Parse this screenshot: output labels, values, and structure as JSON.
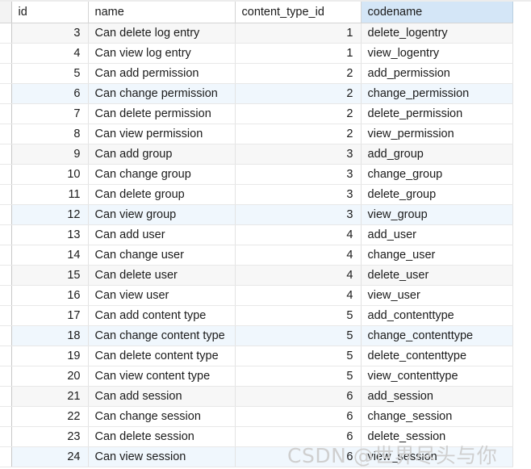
{
  "grid": {
    "columns": [
      {
        "key": "gutter",
        "label": "",
        "align": "left",
        "selected": false
      },
      {
        "key": "id",
        "label": "id",
        "align": "right",
        "selected": false
      },
      {
        "key": "name",
        "label": "name",
        "align": "left",
        "selected": false
      },
      {
        "key": "content_type_id",
        "label": "content_type_id",
        "align": "right",
        "selected": false
      },
      {
        "key": "codename",
        "label": "codename",
        "align": "left",
        "selected": true
      }
    ],
    "selected_column": "codename",
    "colors": {
      "header_selected_bg": "#d4e6f7",
      "row_white_bg": "#ffffff",
      "row_grey_bg": "#f7f7f7",
      "row_blue_bg": "#f0f7fd",
      "grid_line": "#e3e3e3",
      "header_border": "#d4d4d4",
      "text": "#1b1b1b",
      "watermark": "#cfcfcf"
    },
    "rows": [
      {
        "id": "3",
        "name": "Can delete log entry",
        "content_type_id": "1",
        "codename": "delete_logentry",
        "stripe": "grey"
      },
      {
        "id": "4",
        "name": "Can view log entry",
        "content_type_id": "1",
        "codename": "view_logentry",
        "stripe": "white"
      },
      {
        "id": "5",
        "name": "Can add permission",
        "content_type_id": "2",
        "codename": "add_permission",
        "stripe": "white"
      },
      {
        "id": "6",
        "name": "Can change permission",
        "content_type_id": "2",
        "codename": "change_permission",
        "stripe": "blue"
      },
      {
        "id": "7",
        "name": "Can delete permission",
        "content_type_id": "2",
        "codename": "delete_permission",
        "stripe": "white"
      },
      {
        "id": "8",
        "name": "Can view permission",
        "content_type_id": "2",
        "codename": "view_permission",
        "stripe": "white"
      },
      {
        "id": "9",
        "name": "Can add group",
        "content_type_id": "3",
        "codename": "add_group",
        "stripe": "grey"
      },
      {
        "id": "10",
        "name": "Can change group",
        "content_type_id": "3",
        "codename": "change_group",
        "stripe": "white"
      },
      {
        "id": "11",
        "name": "Can delete group",
        "content_type_id": "3",
        "codename": "delete_group",
        "stripe": "white"
      },
      {
        "id": "12",
        "name": "Can view group",
        "content_type_id": "3",
        "codename": "view_group",
        "stripe": "blue"
      },
      {
        "id": "13",
        "name": "Can add user",
        "content_type_id": "4",
        "codename": "add_user",
        "stripe": "white"
      },
      {
        "id": "14",
        "name": "Can change user",
        "content_type_id": "4",
        "codename": "change_user",
        "stripe": "white"
      },
      {
        "id": "15",
        "name": "Can delete user",
        "content_type_id": "4",
        "codename": "delete_user",
        "stripe": "grey"
      },
      {
        "id": "16",
        "name": "Can view user",
        "content_type_id": "4",
        "codename": "view_user",
        "stripe": "white"
      },
      {
        "id": "17",
        "name": "Can add content type",
        "content_type_id": "5",
        "codename": "add_contenttype",
        "stripe": "white"
      },
      {
        "id": "18",
        "name": "Can change content type",
        "content_type_id": "5",
        "codename": "change_contenttype",
        "stripe": "blue"
      },
      {
        "id": "19",
        "name": "Can delete content type",
        "content_type_id": "5",
        "codename": "delete_contenttype",
        "stripe": "white"
      },
      {
        "id": "20",
        "name": "Can view content type",
        "content_type_id": "5",
        "codename": "view_contenttype",
        "stripe": "white"
      },
      {
        "id": "21",
        "name": "Can add session",
        "content_type_id": "6",
        "codename": "add_session",
        "stripe": "grey"
      },
      {
        "id": "22",
        "name": "Can change session",
        "content_type_id": "6",
        "codename": "change_session",
        "stripe": "white"
      },
      {
        "id": "23",
        "name": "Can delete session",
        "content_type_id": "6",
        "codename": "delete_session",
        "stripe": "white"
      },
      {
        "id": "24",
        "name": "Can view session",
        "content_type_id": "6",
        "codename": "view_session",
        "stripe": "blue"
      }
    ]
  },
  "watermark": {
    "text": "CSDN @世界尽头与你"
  }
}
